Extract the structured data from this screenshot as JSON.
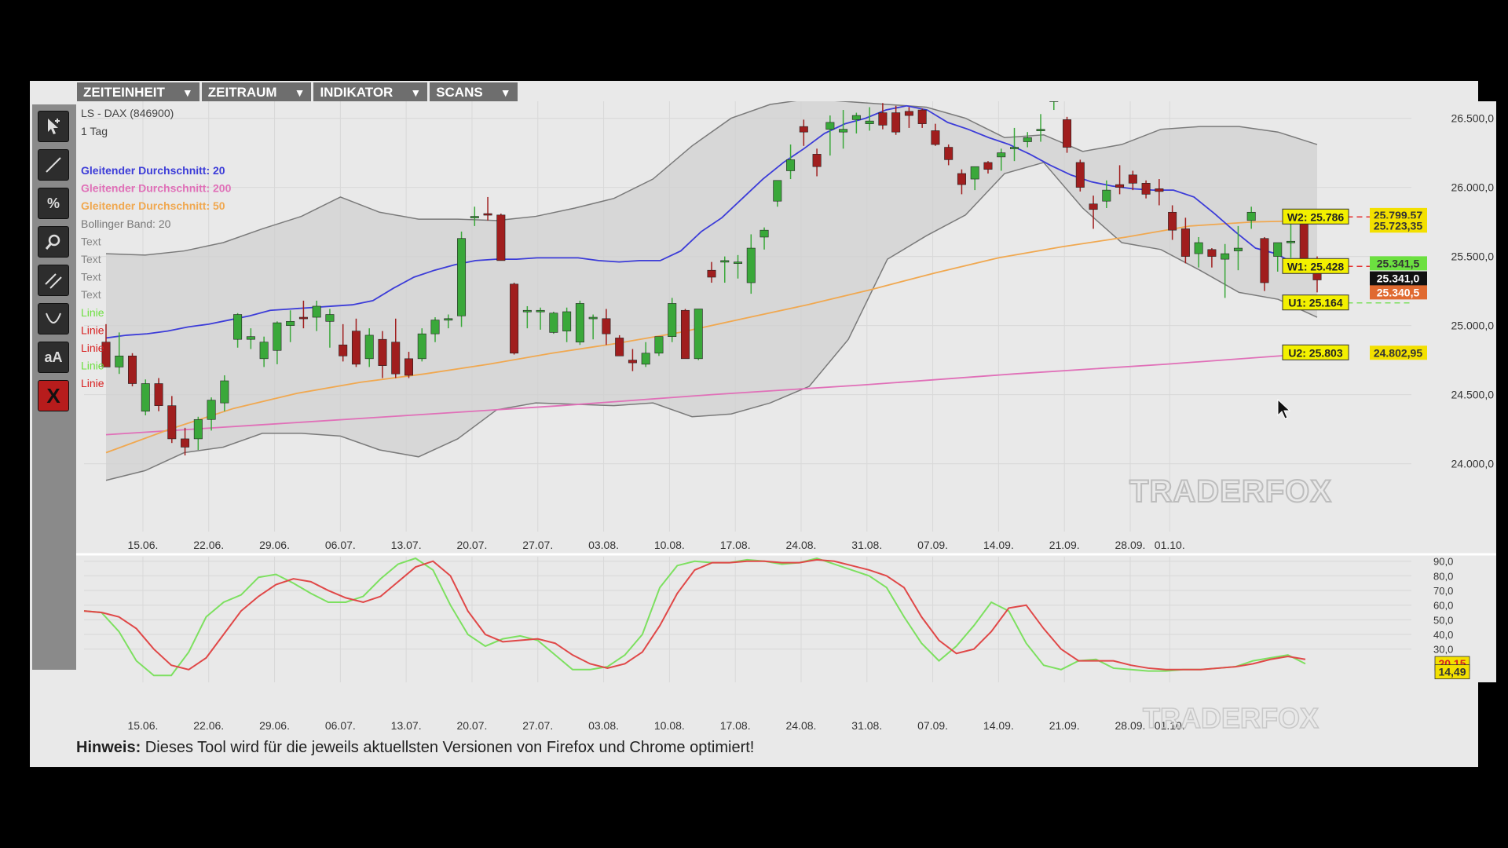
{
  "menu": [
    {
      "label": "ZEITEINHEIT",
      "arrow": "▼"
    },
    {
      "label": "ZEITRAUM",
      "arrow": "▼"
    },
    {
      "label": "INDIKATOR",
      "arrow": "▼"
    },
    {
      "label": "SCANS",
      "arrow": "▼"
    }
  ],
  "toolbar": {
    "icons": [
      "pointer-icon",
      "line-icon",
      "percent-icon",
      "zoom-icon",
      "parallel-lines-icon",
      "curve-icon",
      "text-icon",
      "close-icon"
    ],
    "percent_label": "%",
    "text_label": "aA",
    "close_label": "X"
  },
  "notice": {
    "prefix": "Hinweis:",
    "text": " Dieses Tool wird für die jeweils aktuellsten Versionen von Firefox und Chrome optimiert!"
  },
  "colors": {
    "up": "#3aa83a",
    "down": "#a01e1e",
    "ma20": "#3c3cd8",
    "ma200": "#e070b8",
    "ma50": "#f0a850",
    "band": "#7a7a7a",
    "stoch_k": "#7de060",
    "stoch_d": "#e04848",
    "tag_yellow": "#f3f000"
  },
  "chart_data": {
    "type": "candlestick",
    "instrument": "LS - DAX (846900)",
    "timeframe": "1 Tag",
    "legend": [
      {
        "label": "Gleitender Durchschnitt: 20",
        "color": "#3c3cd8"
      },
      {
        "label": "Gleitender Durchschnitt: 200",
        "color": "#e070b8"
      },
      {
        "label": "Gleitender Durchschnitt: 50",
        "color": "#f0a850"
      },
      {
        "label": "Bollinger Band: 20",
        "color": "#777777"
      },
      {
        "label": "Text",
        "color": "#888888"
      },
      {
        "label": "Text",
        "color": "#888888"
      },
      {
        "label": "Text",
        "color": "#888888"
      },
      {
        "label": "Text",
        "color": "#888888"
      },
      {
        "label": "Linie",
        "color": "#6ce040"
      },
      {
        "label": "Linie",
        "color": "#d82020"
      },
      {
        "label": "Linie",
        "color": "#d82020"
      },
      {
        "label": "Linie",
        "color": "#6ce040"
      },
      {
        "label": "Linie",
        "color": "#d82020"
      }
    ],
    "x_ticks": [
      "15.06.",
      "22.06.",
      "29.06.",
      "06.07.",
      "13.07.",
      "20.07.",
      "27.07.",
      "03.08.",
      "10.08.",
      "17.08.",
      "24.08.",
      "31.08.",
      "07.09.",
      "14.09.",
      "21.09.",
      "28.09.",
      "01.10."
    ],
    "y_ticks": [
      "24.000,0",
      "24.500,0",
      "25.000,0",
      "25.500,0",
      "26.000,0",
      "26.500,0"
    ],
    "ylim": [
      23850,
      26600
    ],
    "candles": [
      [
        24880,
        25010,
        24720,
        24700
      ],
      [
        24700,
        24950,
        24650,
        24780
      ],
      [
        24780,
        24800,
        24560,
        24580
      ],
      [
        24380,
        24610,
        24350,
        24580
      ],
      [
        24580,
        24620,
        24380,
        24420
      ],
      [
        24420,
        24490,
        24150,
        24180
      ],
      [
        24180,
        24260,
        24060,
        24120
      ],
      [
        24180,
        24340,
        24100,
        24320
      ],
      [
        24320,
        24480,
        24240,
        24460
      ],
      [
        24440,
        24640,
        24380,
        24600
      ],
      [
        24900,
        25090,
        24840,
        25080
      ],
      [
        24900,
        24980,
        24830,
        24920
      ],
      [
        24760,
        24920,
        24700,
        24880
      ],
      [
        24820,
        25030,
        24720,
        25020
      ],
      [
        25000,
        25110,
        24880,
        25030
      ],
      [
        25060,
        25180,
        24980,
        25050
      ],
      [
        25060,
        25180,
        24960,
        25140
      ],
      [
        25030,
        25120,
        24840,
        25080
      ],
      [
        24860,
        25010,
        24740,
        24780
      ],
      [
        24960,
        25050,
        24700,
        24720
      ],
      [
        24760,
        24980,
        24700,
        24930
      ],
      [
        24900,
        24960,
        24620,
        24710
      ],
      [
        24880,
        25050,
        24620,
        24650
      ],
      [
        24760,
        24810,
        24620,
        24640
      ],
      [
        24760,
        24980,
        24740,
        24940
      ],
      [
        24940,
        25060,
        24880,
        25040
      ],
      [
        25040,
        25080,
        24980,
        25050
      ],
      [
        25070,
        25680,
        24990,
        25630
      ],
      [
        25780,
        25860,
        25720,
        25790
      ],
      [
        25810,
        25930,
        25760,
        25800
      ],
      [
        25800,
        25810,
        25470,
        25470
      ],
      [
        25300,
        25310,
        24790,
        24800
      ],
      [
        25100,
        25140,
        24980,
        25110
      ],
      [
        25100,
        25130,
        24970,
        25110
      ],
      [
        24950,
        25100,
        24940,
        25090
      ],
      [
        24960,
        25130,
        24880,
        25100
      ],
      [
        24880,
        25180,
        24860,
        25160
      ],
      [
        25060,
        25080,
        24900,
        25060
      ],
      [
        25050,
        25120,
        24860,
        24940
      ],
      [
        24910,
        24930,
        24780,
        24780
      ],
      [
        24750,
        24830,
        24670,
        24730
      ],
      [
        24720,
        24880,
        24700,
        24800
      ],
      [
        24800,
        24920,
        24780,
        24920
      ],
      [
        24920,
        25200,
        24880,
        25160
      ],
      [
        25110,
        25120,
        24770,
        24760
      ],
      [
        24760,
        25100,
        24750,
        25120
      ],
      [
        25400,
        25460,
        25310,
        25350
      ],
      [
        25460,
        25500,
        25310,
        25470
      ],
      [
        25460,
        25510,
        25340,
        25460
      ],
      [
        25310,
        25660,
        25230,
        25560
      ],
      [
        25640,
        25710,
        25550,
        25690
      ],
      [
        25900,
        26050,
        25860,
        26050
      ],
      [
        26120,
        26310,
        26060,
        26200
      ],
      [
        26440,
        26490,
        26300,
        26400
      ],
      [
        26240,
        26280,
        26080,
        26150
      ],
      [
        26420,
        26520,
        26230,
        26470
      ],
      [
        26400,
        26560,
        26280,
        26420
      ],
      [
        26490,
        26540,
        26390,
        26520
      ],
      [
        26460,
        26580,
        26410,
        26480
      ],
      [
        26540,
        26610,
        26420,
        26450
      ],
      [
        26540,
        26590,
        26380,
        26400
      ],
      [
        26550,
        26580,
        26430,
        26520
      ],
      [
        26560,
        26570,
        26430,
        26460
      ],
      [
        26410,
        26460,
        26300,
        26310
      ],
      [
        26290,
        26310,
        26160,
        26200
      ],
      [
        26100,
        26130,
        25950,
        26020
      ],
      [
        26060,
        26130,
        25980,
        26150
      ],
      [
        26180,
        26190,
        26100,
        26130
      ],
      [
        26220,
        26280,
        26120,
        26250
      ],
      [
        26290,
        26430,
        26190,
        26290
      ],
      [
        26330,
        26400,
        26290,
        26360
      ],
      [
        26420,
        26530,
        26330,
        26420
      ],
      [
        26620,
        26660,
        26560,
        26670
      ],
      [
        26490,
        26510,
        26250,
        26290
      ],
      [
        26180,
        26200,
        25970,
        26000
      ],
      [
        25880,
        25940,
        25700,
        25840
      ],
      [
        25900,
        26050,
        25850,
        25980
      ],
      [
        26020,
        26160,
        25950,
        26000
      ],
      [
        26090,
        26120,
        25980,
        26030
      ],
      [
        26030,
        26050,
        25920,
        25950
      ],
      [
        25990,
        26060,
        25870,
        25970
      ],
      [
        25820,
        25870,
        25620,
        25690
      ],
      [
        25700,
        25780,
        25450,
        25500
      ],
      [
        25520,
        25640,
        25420,
        25600
      ],
      [
        25550,
        25560,
        25420,
        25500
      ],
      [
        25480,
        25590,
        25200,
        25520
      ],
      [
        25540,
        25720,
        25400,
        25560
      ],
      [
        25760,
        25860,
        25700,
        25820
      ],
      [
        25630,
        25640,
        25250,
        25310
      ],
      [
        25500,
        25530,
        25390,
        25600
      ],
      [
        25600,
        25830,
        25490,
        25610
      ],
      [
        25760,
        25800,
        25460,
        25480
      ],
      [
        25430,
        25500,
        25240,
        25330
      ]
    ],
    "ma20": [
      24910,
      24930,
      24940,
      24960,
      24990,
      25010,
      25040,
      25070,
      25110,
      25120,
      25130,
      25140,
      25150,
      25180,
      25270,
      25350,
      25400,
      25440,
      25470,
      25480,
      25480,
      25490,
      25490,
      25490,
      25470,
      25460,
      25470,
      25470,
      25540,
      25680,
      25780,
      25920,
      26060,
      26180,
      26280,
      26390,
      26460,
      26500,
      26560,
      26590,
      26560,
      26470,
      26420,
      26360,
      26310,
      26240,
      26160,
      26090,
      26040,
      26010,
      25990,
      25980,
      25980,
      25930,
      25810,
      25680,
      25560,
      25520,
      25440,
      25420
    ],
    "ma200": [
      24210,
      24280,
      24350,
      24420,
      24500,
      24570,
      24650,
      24720,
      24800
    ],
    "ma50": [
      24080,
      24250,
      24400,
      24510,
      24590,
      24650,
      24720,
      24800,
      24870,
      24950,
      25050,
      25150,
      25260,
      25380,
      25490,
      25570,
      25640,
      25720,
      25750,
      25760
    ],
    "bb_upper": [
      25520,
      25510,
      25540,
      25600,
      25700,
      25790,
      25930,
      25820,
      25770,
      25770,
      25760,
      25790,
      25850,
      25920,
      26060,
      26300,
      26500,
      26600,
      26640,
      26620,
      26600,
      26580,
      26500,
      26360,
      26380,
      26260,
      26310,
      26420,
      26440,
      26440,
      26400,
      26310
    ],
    "bb_lower": [
      23880,
      23950,
      24080,
      24120,
      24220,
      24220,
      24200,
      24100,
      24050,
      24180,
      24390,
      24440,
      24430,
      24420,
      24440,
      24340,
      24360,
      24440,
      24560,
      24900,
      25480,
      25650,
      25800,
      26100,
      26180,
      25850,
      25600,
      25550,
      25400,
      25240,
      25190,
      25060
    ],
    "levels": [
      {
        "label": "W2: 25.786",
        "value": 25786,
        "style": "red-dashed"
      },
      {
        "label": "W1: 25.428",
        "value": 25428,
        "style": "red-dashed"
      },
      {
        "label": "U1: 25.164",
        "value": 25164,
        "style": "green-dashed"
      },
      {
        "label": "U2: 25.803",
        "value": 24802.95,
        "style": "none"
      }
    ],
    "price_tags": [
      {
        "label": "25.799,57",
        "value": 25799.57,
        "bg": "#f3e000",
        "fg": "#333"
      },
      {
        "label": "25.723,35",
        "value": 25723.35,
        "bg": "#f3e000",
        "fg": "#333"
      },
      {
        "label": "25.341,5",
        "value": 25450,
        "bg": "#6ce040",
        "fg": "#333"
      },
      {
        "label": "25.341,0",
        "value": 25341,
        "bg": "#111111",
        "fg": "#ffffff"
      },
      {
        "label": "25.340,5",
        "value": 25240,
        "bg": "#e06a30",
        "fg": "#ffffff"
      },
      {
        "label": "24.802,95",
        "value": 24802.95,
        "bg": "#f3e000",
        "fg": "#333"
      }
    ],
    "watermark": "TRADERFOX",
    "stochastic": {
      "y_ticks": [
        "90,0",
        "80,0",
        "70,0",
        "60,0",
        "50,0",
        "40,0",
        "30,0"
      ],
      "ylim": [
        10,
        92
      ],
      "k": [
        56,
        55,
        42,
        22,
        12,
        12,
        28,
        52,
        62,
        67,
        79,
        81,
        75,
        68,
        62,
        62,
        66,
        78,
        88,
        92,
        84,
        60,
        40,
        32,
        37,
        39,
        36,
        26,
        16,
        16,
        18,
        26,
        40,
        72,
        87,
        90,
        89,
        89,
        91,
        90,
        88,
        89,
        92,
        88,
        84,
        80,
        72,
        52,
        34,
        22,
        32,
        46,
        62,
        56,
        34,
        19,
        16,
        22,
        23,
        17,
        16,
        15,
        15,
        16,
        16,
        17,
        18,
        22,
        24,
        26,
        20
      ],
      "d": [
        56,
        55,
        52,
        44,
        30,
        19,
        16,
        24,
        40,
        56,
        66,
        74,
        78,
        76,
        70,
        65,
        62,
        66,
        76,
        86,
        90,
        80,
        56,
        40,
        35,
        36,
        37,
        34,
        26,
        20,
        17,
        20,
        28,
        46,
        68,
        84,
        89,
        89,
        90,
        90,
        89,
        89,
        91,
        90,
        87,
        84,
        80,
        72,
        52,
        36,
        27,
        30,
        42,
        58,
        60,
        44,
        30,
        22,
        22,
        22,
        19,
        17,
        16,
        16,
        16,
        17,
        18,
        20,
        23,
        25,
        23
      ],
      "tags": [
        {
          "label": "20,15",
          "value": 20.15,
          "bg": "#f3e000",
          "fg": "#d82020"
        },
        {
          "label": "14,49",
          "value": 14.49,
          "bg": "#f3e000",
          "fg": "#333"
        }
      ]
    }
  }
}
